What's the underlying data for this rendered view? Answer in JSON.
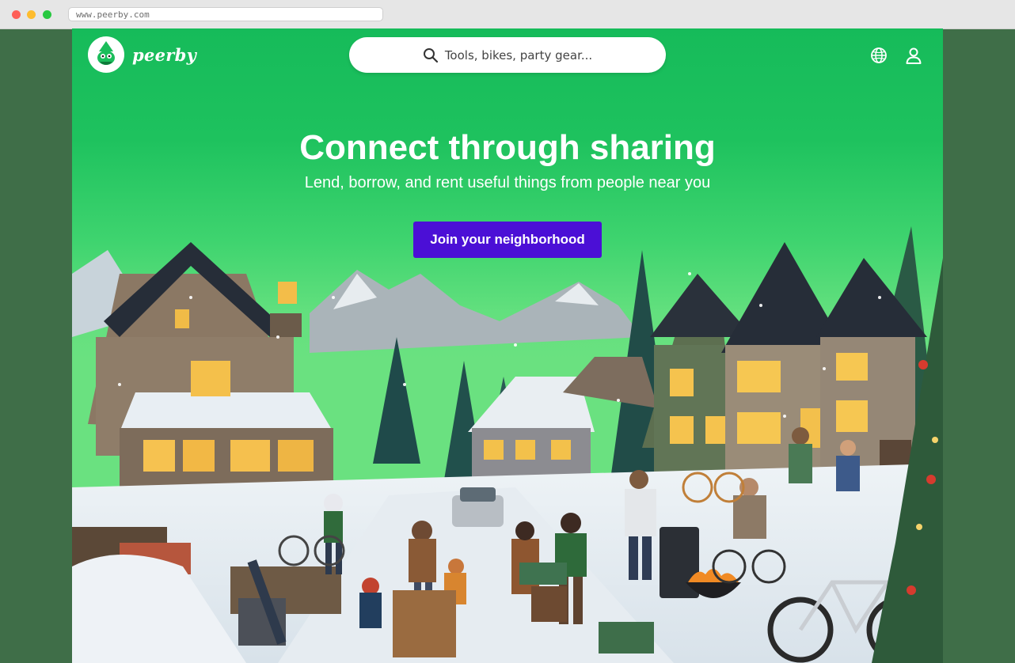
{
  "browser": {
    "url": "www.peerby.com"
  },
  "header": {
    "logo_text": "peerby",
    "search_placeholder": "Tools, bikes, party gear...",
    "icons": [
      "search-icon",
      "globe-icon",
      "user-icon"
    ]
  },
  "hero": {
    "title": "Connect through sharing",
    "subtitle": "Lend, borrow, and rent useful things from people near you",
    "cta_label": "Join your neighborhood"
  },
  "colors": {
    "brand_green": "#16bb5a",
    "cta_purple": "#4b0fd6",
    "outer_background": "#3f6e48"
  }
}
